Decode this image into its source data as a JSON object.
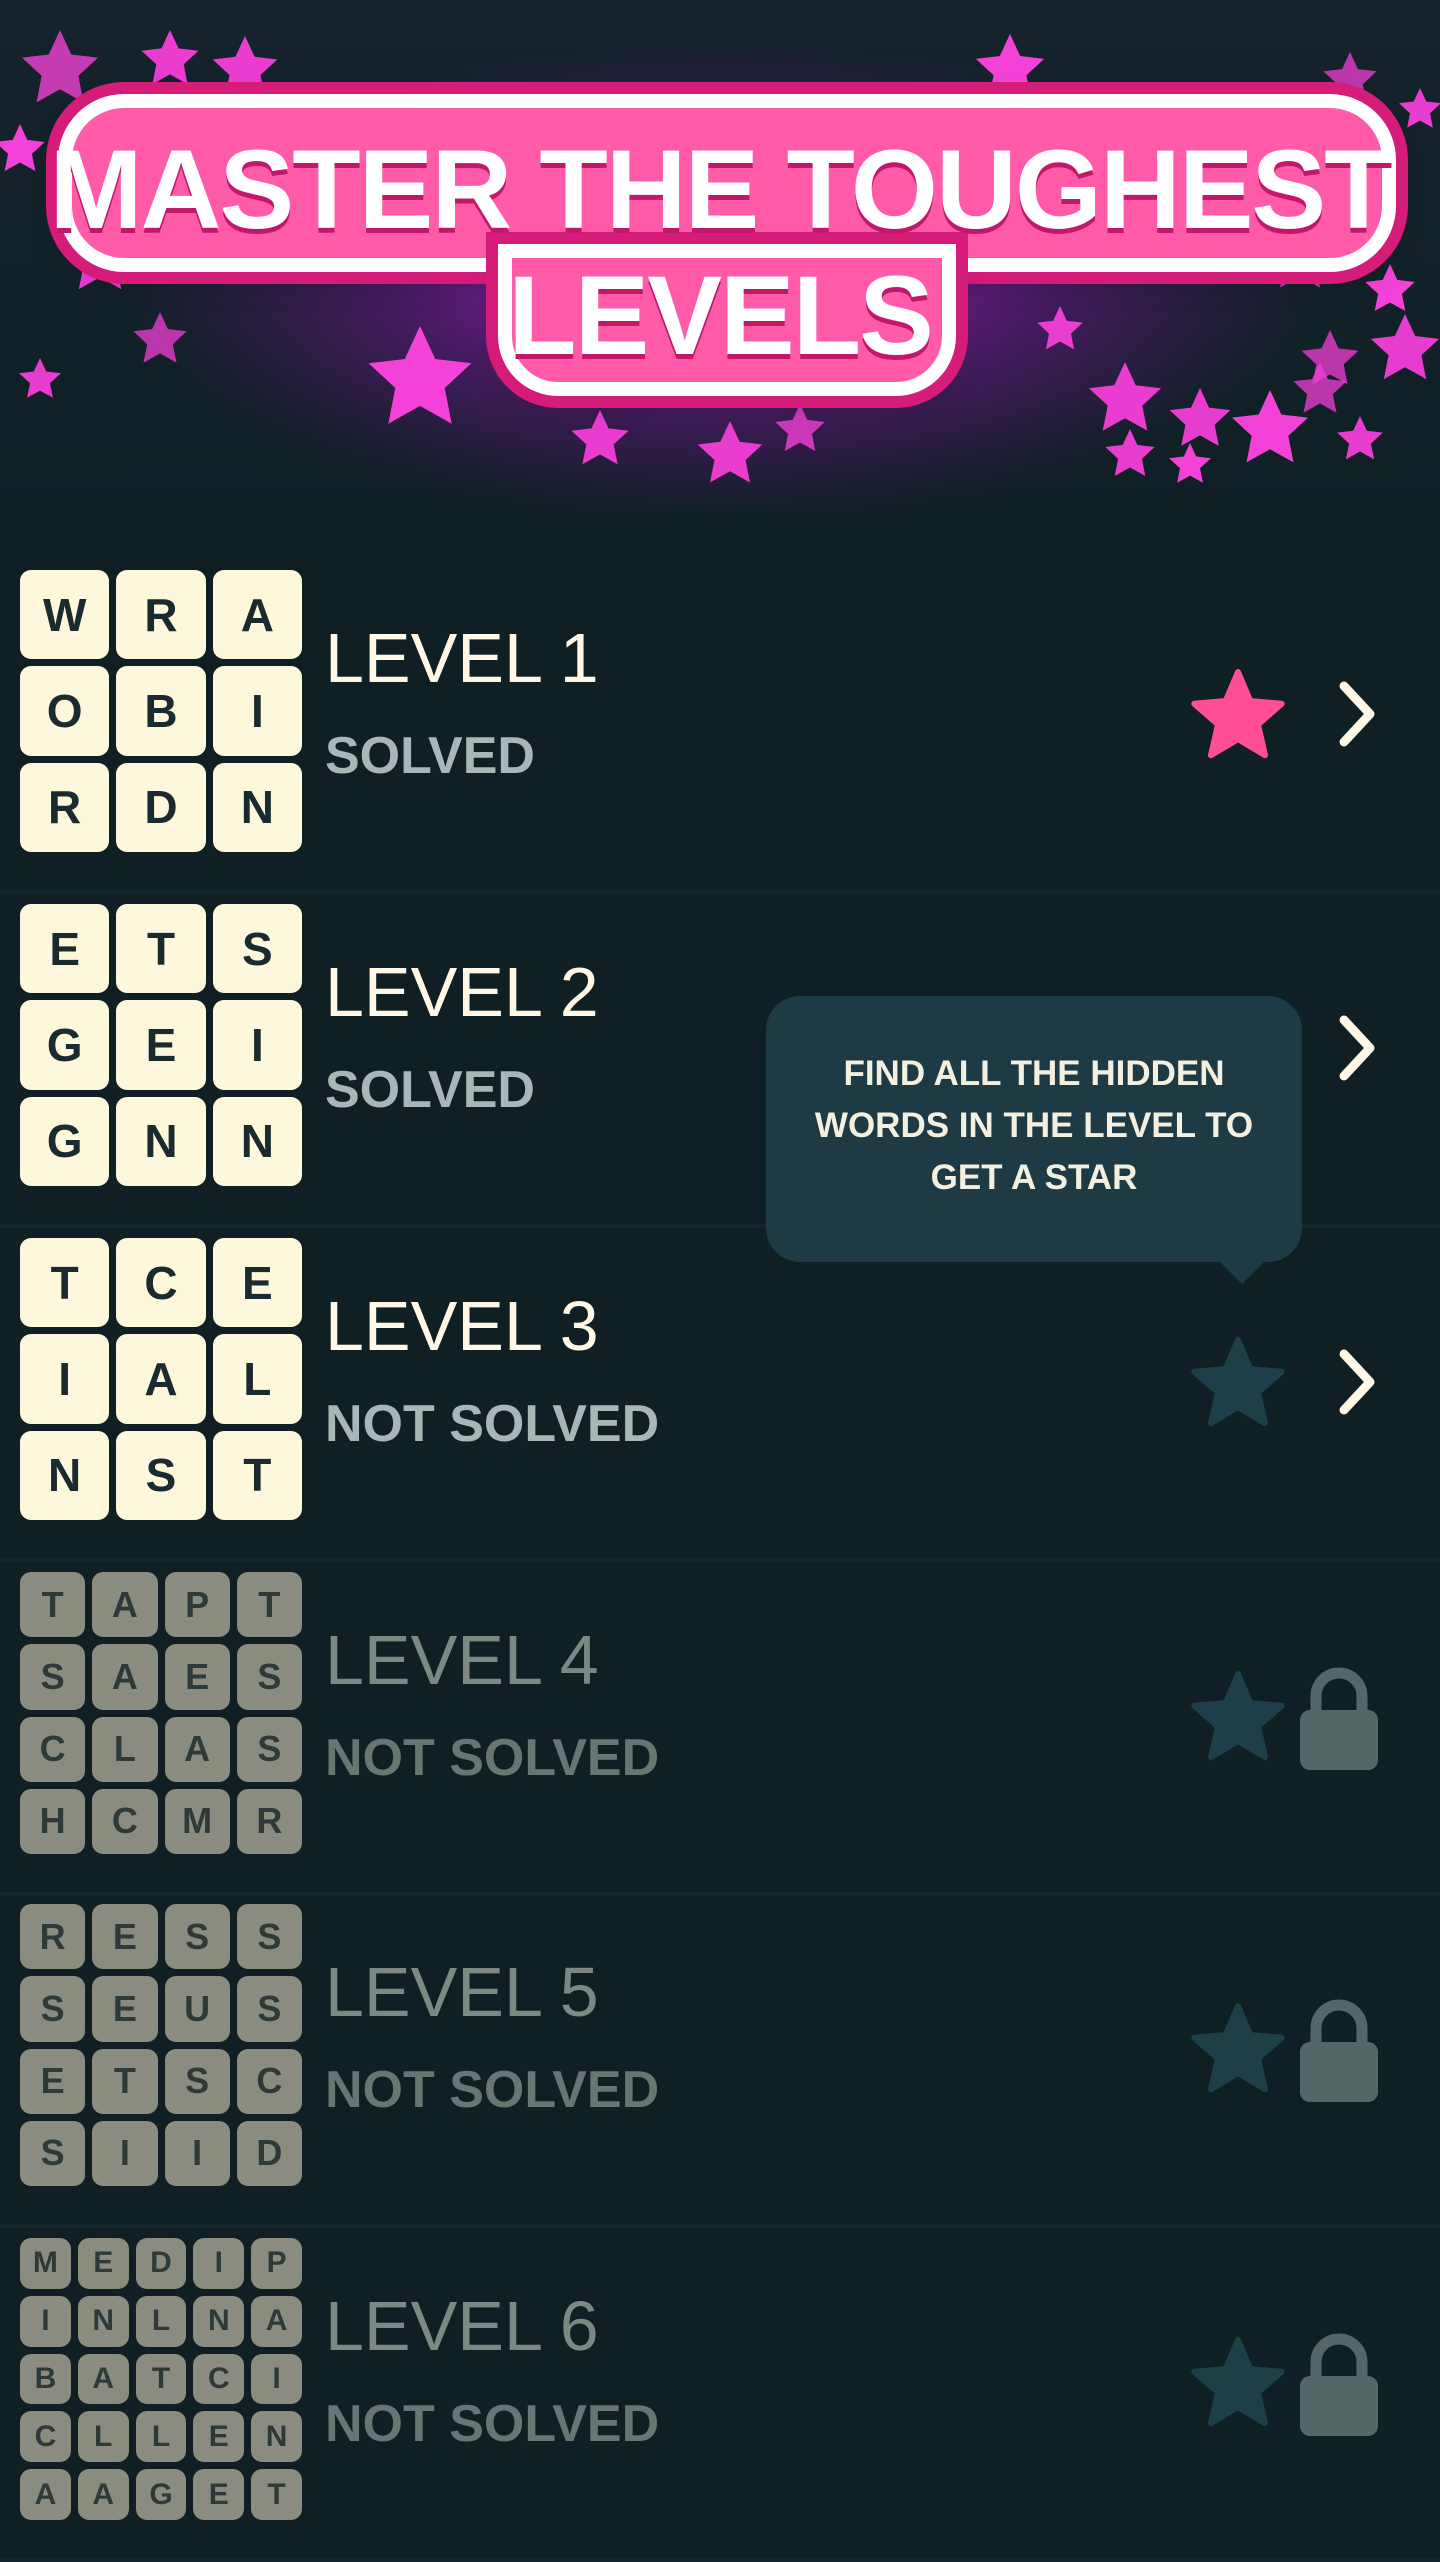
{
  "header": {
    "title_line1": "MASTER THE TOUGHEST",
    "title_line2": "LEVELS"
  },
  "colors": {
    "background": "#0f1f24",
    "banner_pink": "#ff5ba8",
    "banner_border": "#d41c78",
    "star_earned": "#ff4f93",
    "star_empty": "#1e3f48",
    "tile_active": "#fdf8dc",
    "tile_locked": "#8a8c80",
    "tooltip_bg": "#1d3a45"
  },
  "levels": [
    {
      "title": "LEVEL 1",
      "status": "SOLVED",
      "locked": false,
      "star_earned": true,
      "show_star": true,
      "grid": [
        [
          "W",
          "R",
          "A"
        ],
        [
          "O",
          "B",
          "I"
        ],
        [
          "R",
          "D",
          "N"
        ]
      ]
    },
    {
      "title": "LEVEL 2",
      "status": "SOLVED",
      "locked": false,
      "star_earned": false,
      "show_star": false,
      "grid": [
        [
          "E",
          "T",
          "S"
        ],
        [
          "G",
          "E",
          "I"
        ],
        [
          "G",
          "N",
          "N"
        ]
      ]
    },
    {
      "title": "LEVEL 3",
      "status": "NOT SOLVED",
      "locked": false,
      "star_earned": false,
      "show_star": true,
      "grid": [
        [
          "T",
          "C",
          "E"
        ],
        [
          "I",
          "A",
          "L"
        ],
        [
          "N",
          "S",
          "T"
        ]
      ]
    },
    {
      "title": "LEVEL 4",
      "status": "NOT SOLVED",
      "locked": true,
      "star_earned": false,
      "show_star": true,
      "grid": [
        [
          "T",
          "A",
          "P",
          "T"
        ],
        [
          "S",
          "A",
          "E",
          "S"
        ],
        [
          "C",
          "L",
          "A",
          "S"
        ],
        [
          "H",
          "C",
          "M",
          "R"
        ]
      ]
    },
    {
      "title": "LEVEL 5",
      "status": "NOT SOLVED",
      "locked": true,
      "star_earned": false,
      "show_star": true,
      "grid": [
        [
          "R",
          "E",
          "S",
          "S"
        ],
        [
          "S",
          "E",
          "U",
          "S"
        ],
        [
          "E",
          "T",
          "S",
          "C"
        ],
        [
          "S",
          "I",
          "I",
          "D"
        ]
      ]
    },
    {
      "title": "LEVEL 6",
      "status": "NOT SOLVED",
      "locked": true,
      "star_earned": false,
      "show_star": true,
      "grid": [
        [
          "M",
          "E",
          "D",
          "I",
          "P"
        ],
        [
          "I",
          "N",
          "L",
          "N",
          "A"
        ],
        [
          "B",
          "A",
          "T",
          "C",
          "I"
        ],
        [
          "C",
          "L",
          "L",
          "E",
          "N"
        ],
        [
          "A",
          "A",
          "G",
          "E",
          "T"
        ]
      ]
    }
  ],
  "tooltip": {
    "line1": "FIND ALL THE HIDDEN",
    "line2": "WORDS IN THE LEVEL TO",
    "line3": "GET A STAR"
  },
  "icons": {
    "star": "star-icon",
    "chevron": "chevron-right-icon",
    "lock": "lock-icon"
  }
}
